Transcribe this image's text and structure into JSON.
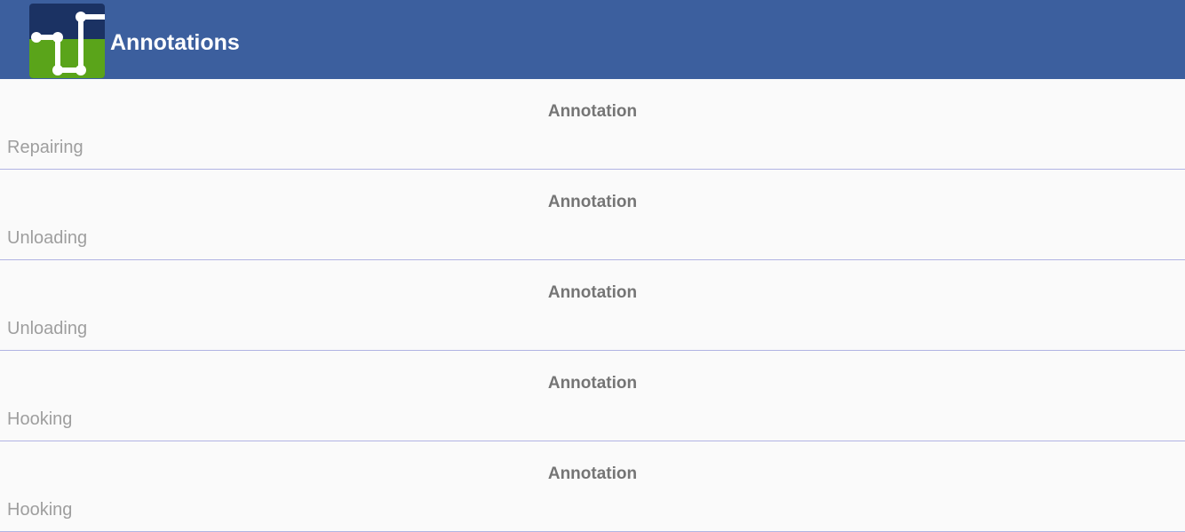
{
  "appbar": {
    "title": "Annotations",
    "logo_icon": "route-logo-icon",
    "color": "#3c5f9e"
  },
  "list": {
    "items": [
      {
        "title": "Annotation",
        "subtitle": "Repairing"
      },
      {
        "title": "Annotation",
        "subtitle": "Unloading"
      },
      {
        "title": "Annotation",
        "subtitle": "Unloading"
      },
      {
        "title": "Annotation",
        "subtitle": "Hooking"
      },
      {
        "title": "Annotation",
        "subtitle": "Hooking"
      }
    ],
    "divider_color": "#b1b4e3"
  }
}
